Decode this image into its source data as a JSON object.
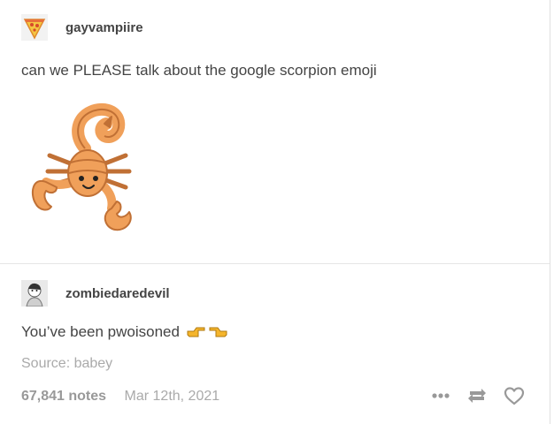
{
  "original_post": {
    "username": "gayvampiire",
    "text": "can we PLEASE talk about the google scorpion emoji",
    "image_icon": "scorpion-emoji"
  },
  "reply": {
    "username": "zombiedaredevil",
    "text": "You’ve been pwoisoned",
    "emoji_icons": [
      "pointing-right-hand-emoji",
      "pointing-left-hand-emoji"
    ]
  },
  "source": {
    "text": "Source: babey"
  },
  "footer": {
    "notes": "67,841 notes",
    "date": "Mar 12th, 2021"
  },
  "colors": {
    "scorpion": "#f0a05a",
    "scorpion_dark": "#c07035",
    "hand": "#f5b52c"
  },
  "actions": {
    "icons": [
      "more-icon",
      "reblog-icon",
      "heart-icon"
    ]
  }
}
